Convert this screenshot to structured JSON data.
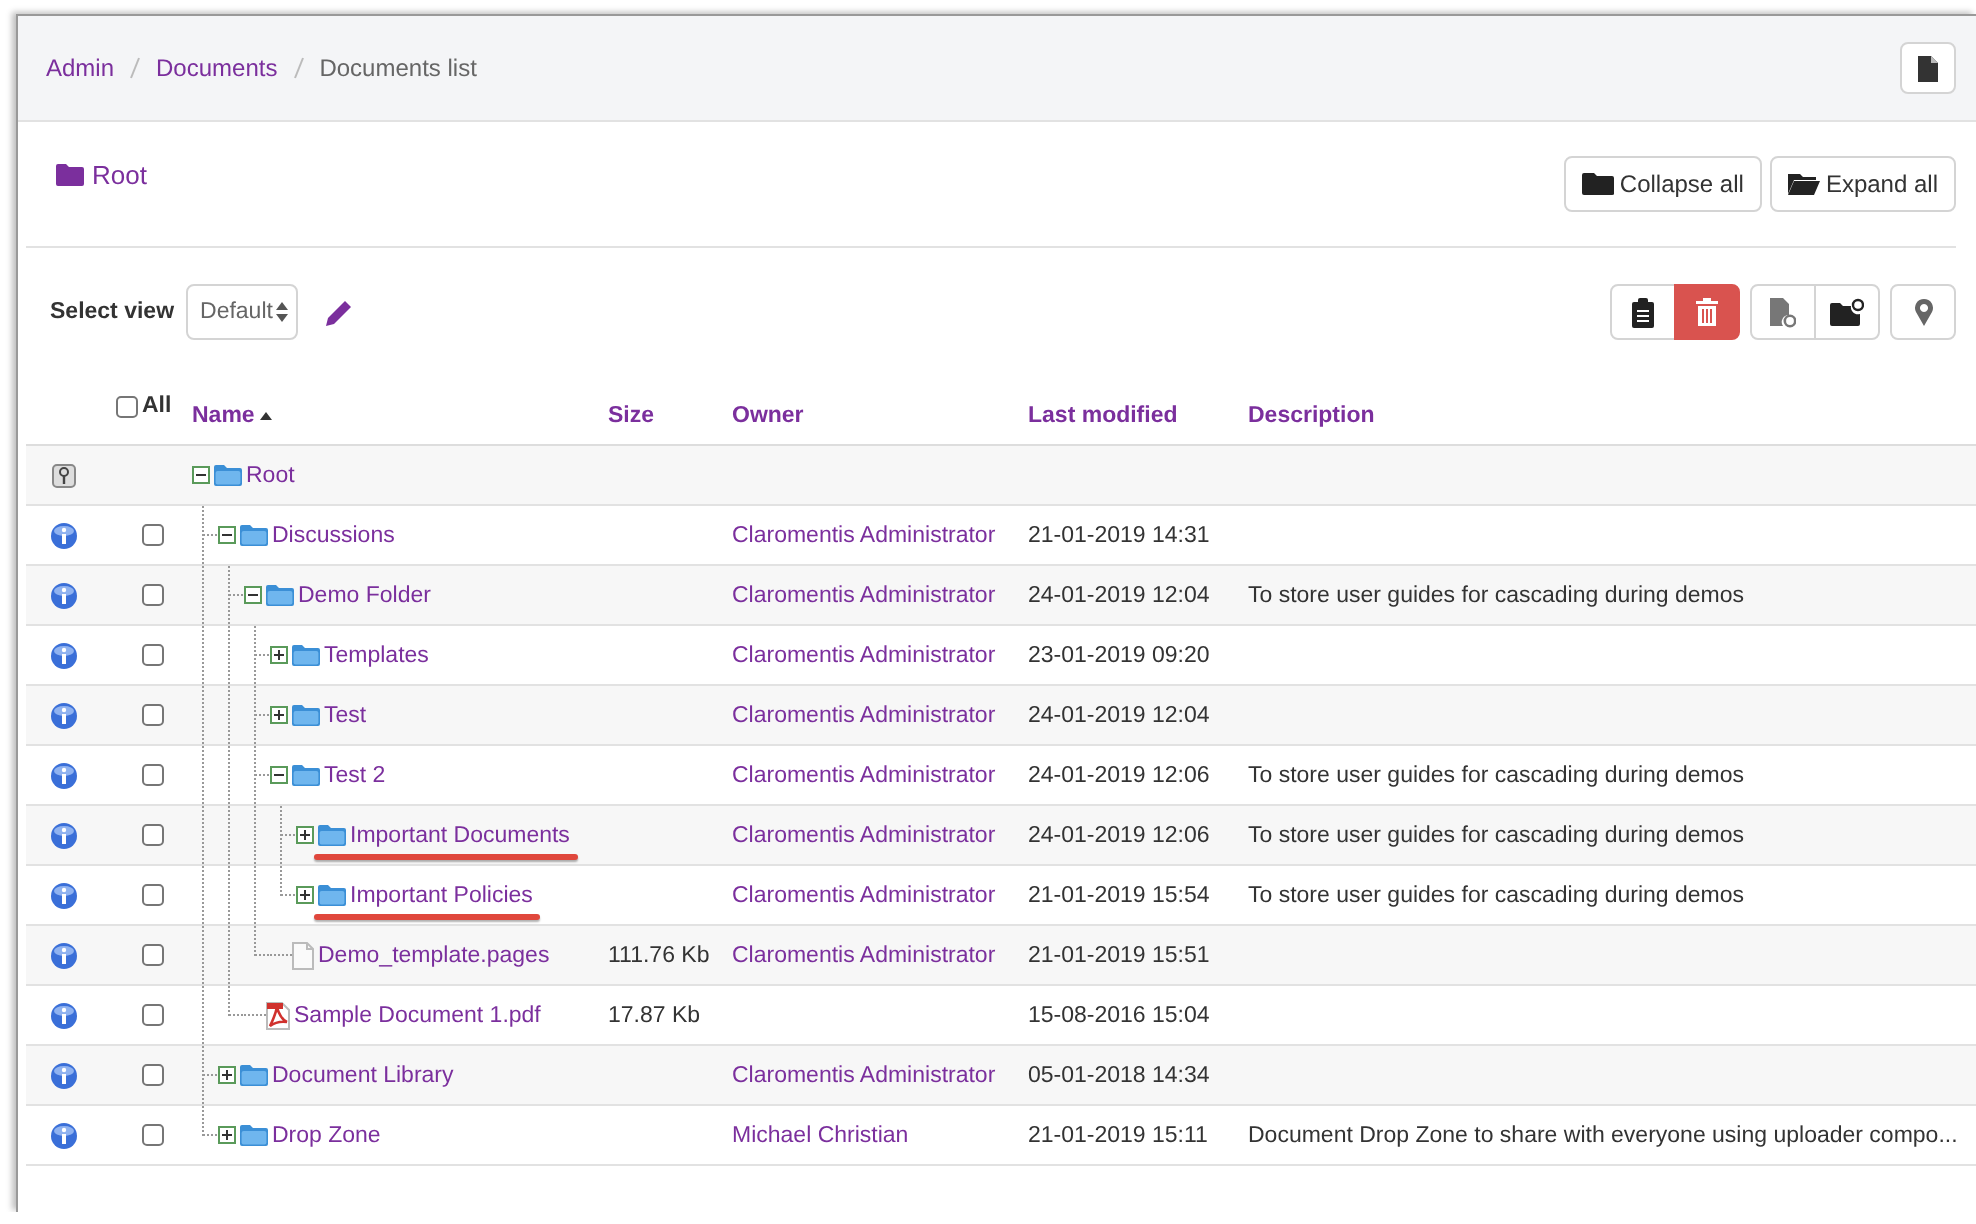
{
  "breadcrumb": [
    {
      "label": "Admin",
      "link": true
    },
    {
      "label": "Documents",
      "link": true
    },
    {
      "label": "Documents list",
      "link": false
    }
  ],
  "heading": {
    "label": "Root"
  },
  "header_buttons": [
    {
      "label": "Collapse all",
      "kind": "collapse"
    },
    {
      "label": "Expand all",
      "kind": "expand"
    }
  ],
  "view_selector": {
    "label": "Select view",
    "value": "Default"
  },
  "table": {
    "select_all": {
      "label": "All",
      "checked": false
    },
    "columns": [
      {
        "label": "Name",
        "sorted": true
      },
      {
        "label": "Size",
        "sorted": false
      },
      {
        "label": "Owner",
        "sorted": false
      },
      {
        "label": "Last modified",
        "sorted": false
      },
      {
        "label": "Description",
        "sorted": false
      }
    ],
    "tree": [
      {
        "kind": "root",
        "name": "Root",
        "expanded": true,
        "children": [
          {
            "kind": "folder",
            "name": "Discussions",
            "expanded": true,
            "checked": false,
            "owner": "Claromentis Administrator",
            "modified": "21-01-2019 14:31",
            "children": [
              {
                "kind": "folder",
                "name": "Demo Folder",
                "expanded": true,
                "checked": false,
                "owner": "Claromentis Administrator",
                "modified": "24-01-2019 12:04",
                "description": "To store user guides for cascading during demos",
                "children": [
                  {
                    "kind": "folder",
                    "name": "Templates",
                    "expanded": false,
                    "checked": false,
                    "owner": "Claromentis Administrator",
                    "modified": "23-01-2019 09:20"
                  },
                  {
                    "kind": "folder",
                    "name": "Test",
                    "expanded": false,
                    "checked": false,
                    "owner": "Claromentis Administrator",
                    "modified": "24-01-2019 12:04"
                  },
                  {
                    "kind": "folder",
                    "name": "Test 2",
                    "expanded": true,
                    "checked": false,
                    "owner": "Claromentis Administrator",
                    "modified": "24-01-2019 12:06",
                    "description": "To store user guides for cascading during demos",
                    "children": [
                      {
                        "kind": "folder",
                        "name": "Important Documents",
                        "expanded": false,
                        "checked": false,
                        "highlighted": true,
                        "owner": "Claromentis Administrator",
                        "modified": "24-01-2019 12:06",
                        "description": "To store user guides for cascading during demos"
                      },
                      {
                        "kind": "folder",
                        "name": "Important Policies",
                        "expanded": false,
                        "checked": false,
                        "highlighted": true,
                        "owner": "Claromentis Administrator",
                        "modified": "21-01-2019 15:54",
                        "description": "To store user guides for cascading during demos"
                      }
                    ]
                  },
                  {
                    "kind": "file",
                    "name": "Demo_template.pages",
                    "checked": false,
                    "size": "111.76 Kb",
                    "owner": "Claromentis Administrator",
                    "modified": "21-01-2019 15:51"
                  }
                ]
              },
              {
                "kind": "pdf",
                "name": "Sample Document 1.pdf",
                "checked": false,
                "size": "17.87 Kb",
                "modified": "15-08-2016 15:04"
              }
            ]
          },
          {
            "kind": "folder",
            "name": "Document Library",
            "expanded": false,
            "checked": false,
            "owner": "Claromentis Administrator",
            "modified": "05-01-2018 14:34"
          },
          {
            "kind": "folder",
            "name": "Drop Zone",
            "expanded": false,
            "checked": false,
            "owner": "Michael Christian",
            "modified": "21-01-2019 15:11",
            "description": "Document Drop Zone to share with everyone using uploader compo..."
          }
        ]
      }
    ]
  }
}
